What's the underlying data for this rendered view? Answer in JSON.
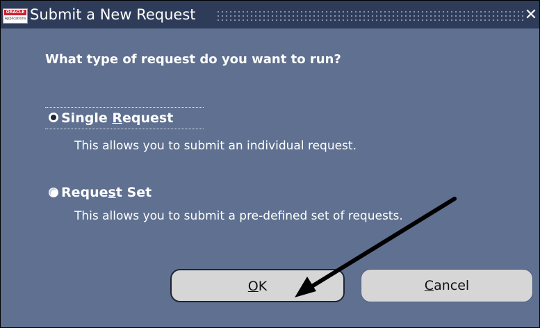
{
  "window": {
    "title": "Submit a New Request",
    "close_glyph": "✕",
    "app_icon": "oracle-applications-logo",
    "logo_text": "ORACLE",
    "logo_subtext": "Applications"
  },
  "dialog": {
    "question": "What type of request do you want to run?",
    "options": [
      {
        "label_prefix": "Single ",
        "label_mnemonic": "R",
        "label_suffix": "equest",
        "description": "This allows you to submit an individual request.",
        "selected": true
      },
      {
        "label_prefix": "Reque",
        "label_mnemonic": "s",
        "label_suffix": "t Set",
        "description": "This allows you to submit a pre-defined set of requests.",
        "selected": false
      }
    ]
  },
  "buttons": {
    "ok_mnemonic": "O",
    "ok_suffix": "K",
    "cancel_mnemonic": "C",
    "cancel_suffix": "ancel"
  },
  "colors": {
    "dialog_background": "#5f7090",
    "titlebar_background": "#2e3c5a",
    "button_face": "#d6d6d6",
    "annotation_arrow": "#000000"
  },
  "annotation": {
    "type": "arrow-icon",
    "points_to": "ok-button"
  }
}
